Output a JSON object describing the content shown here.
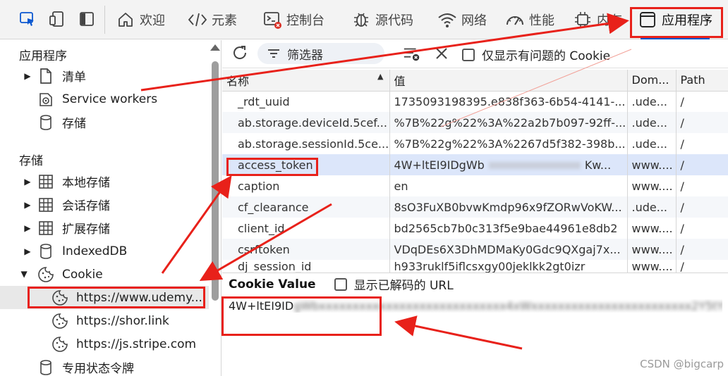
{
  "toolbar": {
    "tabs": [
      {
        "label": "欢迎",
        "icon": "home-icon"
      },
      {
        "label": "元素",
        "icon": "code-tags-icon"
      },
      {
        "label": "控制台",
        "icon": "console-icon"
      },
      {
        "label": "源代码",
        "icon": "bug-icon"
      },
      {
        "label": "网络",
        "icon": "wifi-icon"
      },
      {
        "label": "性能",
        "icon": "gauge-icon"
      },
      {
        "label": "内存",
        "icon": "chip-icon"
      },
      {
        "label": "应用程序",
        "icon": "application-icon",
        "active": true
      }
    ]
  },
  "sidebar": {
    "app_section": "应用程序",
    "app_items": [
      {
        "label": "清单",
        "icon": "document-icon",
        "expandable": true
      },
      {
        "label": "Service workers",
        "icon": "gear-icon"
      },
      {
        "label": "存储",
        "icon": "database-icon"
      }
    ],
    "storage_section": "存储",
    "storage_items": [
      {
        "label": "本地存储",
        "icon": "grid-icon",
        "expandable": true
      },
      {
        "label": "会话存储",
        "icon": "grid-icon",
        "expandable": true
      },
      {
        "label": "扩展存储",
        "icon": "grid-icon",
        "expandable": true
      },
      {
        "label": "IndexedDB",
        "icon": "database-icon",
        "expandable": true
      },
      {
        "label": "Cookie",
        "icon": "cookie-icon",
        "expanded": true
      },
      {
        "label": "https://www.udemy....",
        "icon": "cookie-icon",
        "selected": true
      },
      {
        "label": "https://shor.link",
        "icon": "cookie-icon"
      },
      {
        "label": "https://js.stripe.com",
        "icon": "cookie-icon"
      },
      {
        "label": "专用状态令牌",
        "icon": "database-icon"
      }
    ]
  },
  "filterbar": {
    "filter_placeholder": "筛选器",
    "only_issues_label": "仅显示有问题的 Cookie"
  },
  "table": {
    "columns": [
      "名称",
      "值",
      "Dom...",
      "Path"
    ],
    "rows": [
      {
        "name": "_rdt_uuid",
        "value": "1735093198395.e838f363-6b54-4141-...",
        "domain": ".ude...",
        "path": "/"
      },
      {
        "name": "ab.storage.deviceId.5cef...",
        "value": "%7B%22g%22%3A%22a2b7b097-92ff-...",
        "domain": ".ude...",
        "path": "/"
      },
      {
        "name": "ab.storage.sessionId.5ce...",
        "value": "%7B%22g%22%3A%2267d5f382-398b...",
        "domain": ".ude...",
        "path": "/"
      },
      {
        "name": "access_token",
        "value": "4W+ltEI9IDgWb",
        "value_tail": "Kw...",
        "domain": "www....",
        "path": "/",
        "selected": true
      },
      {
        "name": "caption",
        "value": "en",
        "domain": "www....",
        "path": "/"
      },
      {
        "name": "cf_clearance",
        "value": "8sO3FuXB0bvwKmdp96x9fZORwVoKW...",
        "domain": ".ude...",
        "path": "/"
      },
      {
        "name": "client_id",
        "value": "bd2565cb7b0c313f5e9bae44961e8db2",
        "domain": "www....",
        "path": "/"
      },
      {
        "name": "csrftoken",
        "value": "VDqDEs6X3DhMDMaKy0Gdc9QXgaj7x...",
        "domain": "www....",
        "path": "/"
      },
      {
        "name": "dj_session_id",
        "value": "h933ruklf5iflcsxgy00jeklkk2gt0izr",
        "domain": "www....",
        "path": "/"
      }
    ]
  },
  "cookie_value": {
    "title": "Cookie Value",
    "decode_label": "显示已解码的 URL",
    "value_visible": "4W+ltEI9ID",
    "value_masked": "gWbxxxxxxxxxxxxxxxxxxxxxxxxxxxx4xWxxxxxxxxxxxxxxxxxxxxxxxx2Y5tYxxOBlxxY5kxx"
  },
  "watermark": "CSDN @bigcarp",
  "colors": {
    "accent": "#0b57d0",
    "annotation": "#e8211a",
    "selected_row": "#dce6fa"
  }
}
